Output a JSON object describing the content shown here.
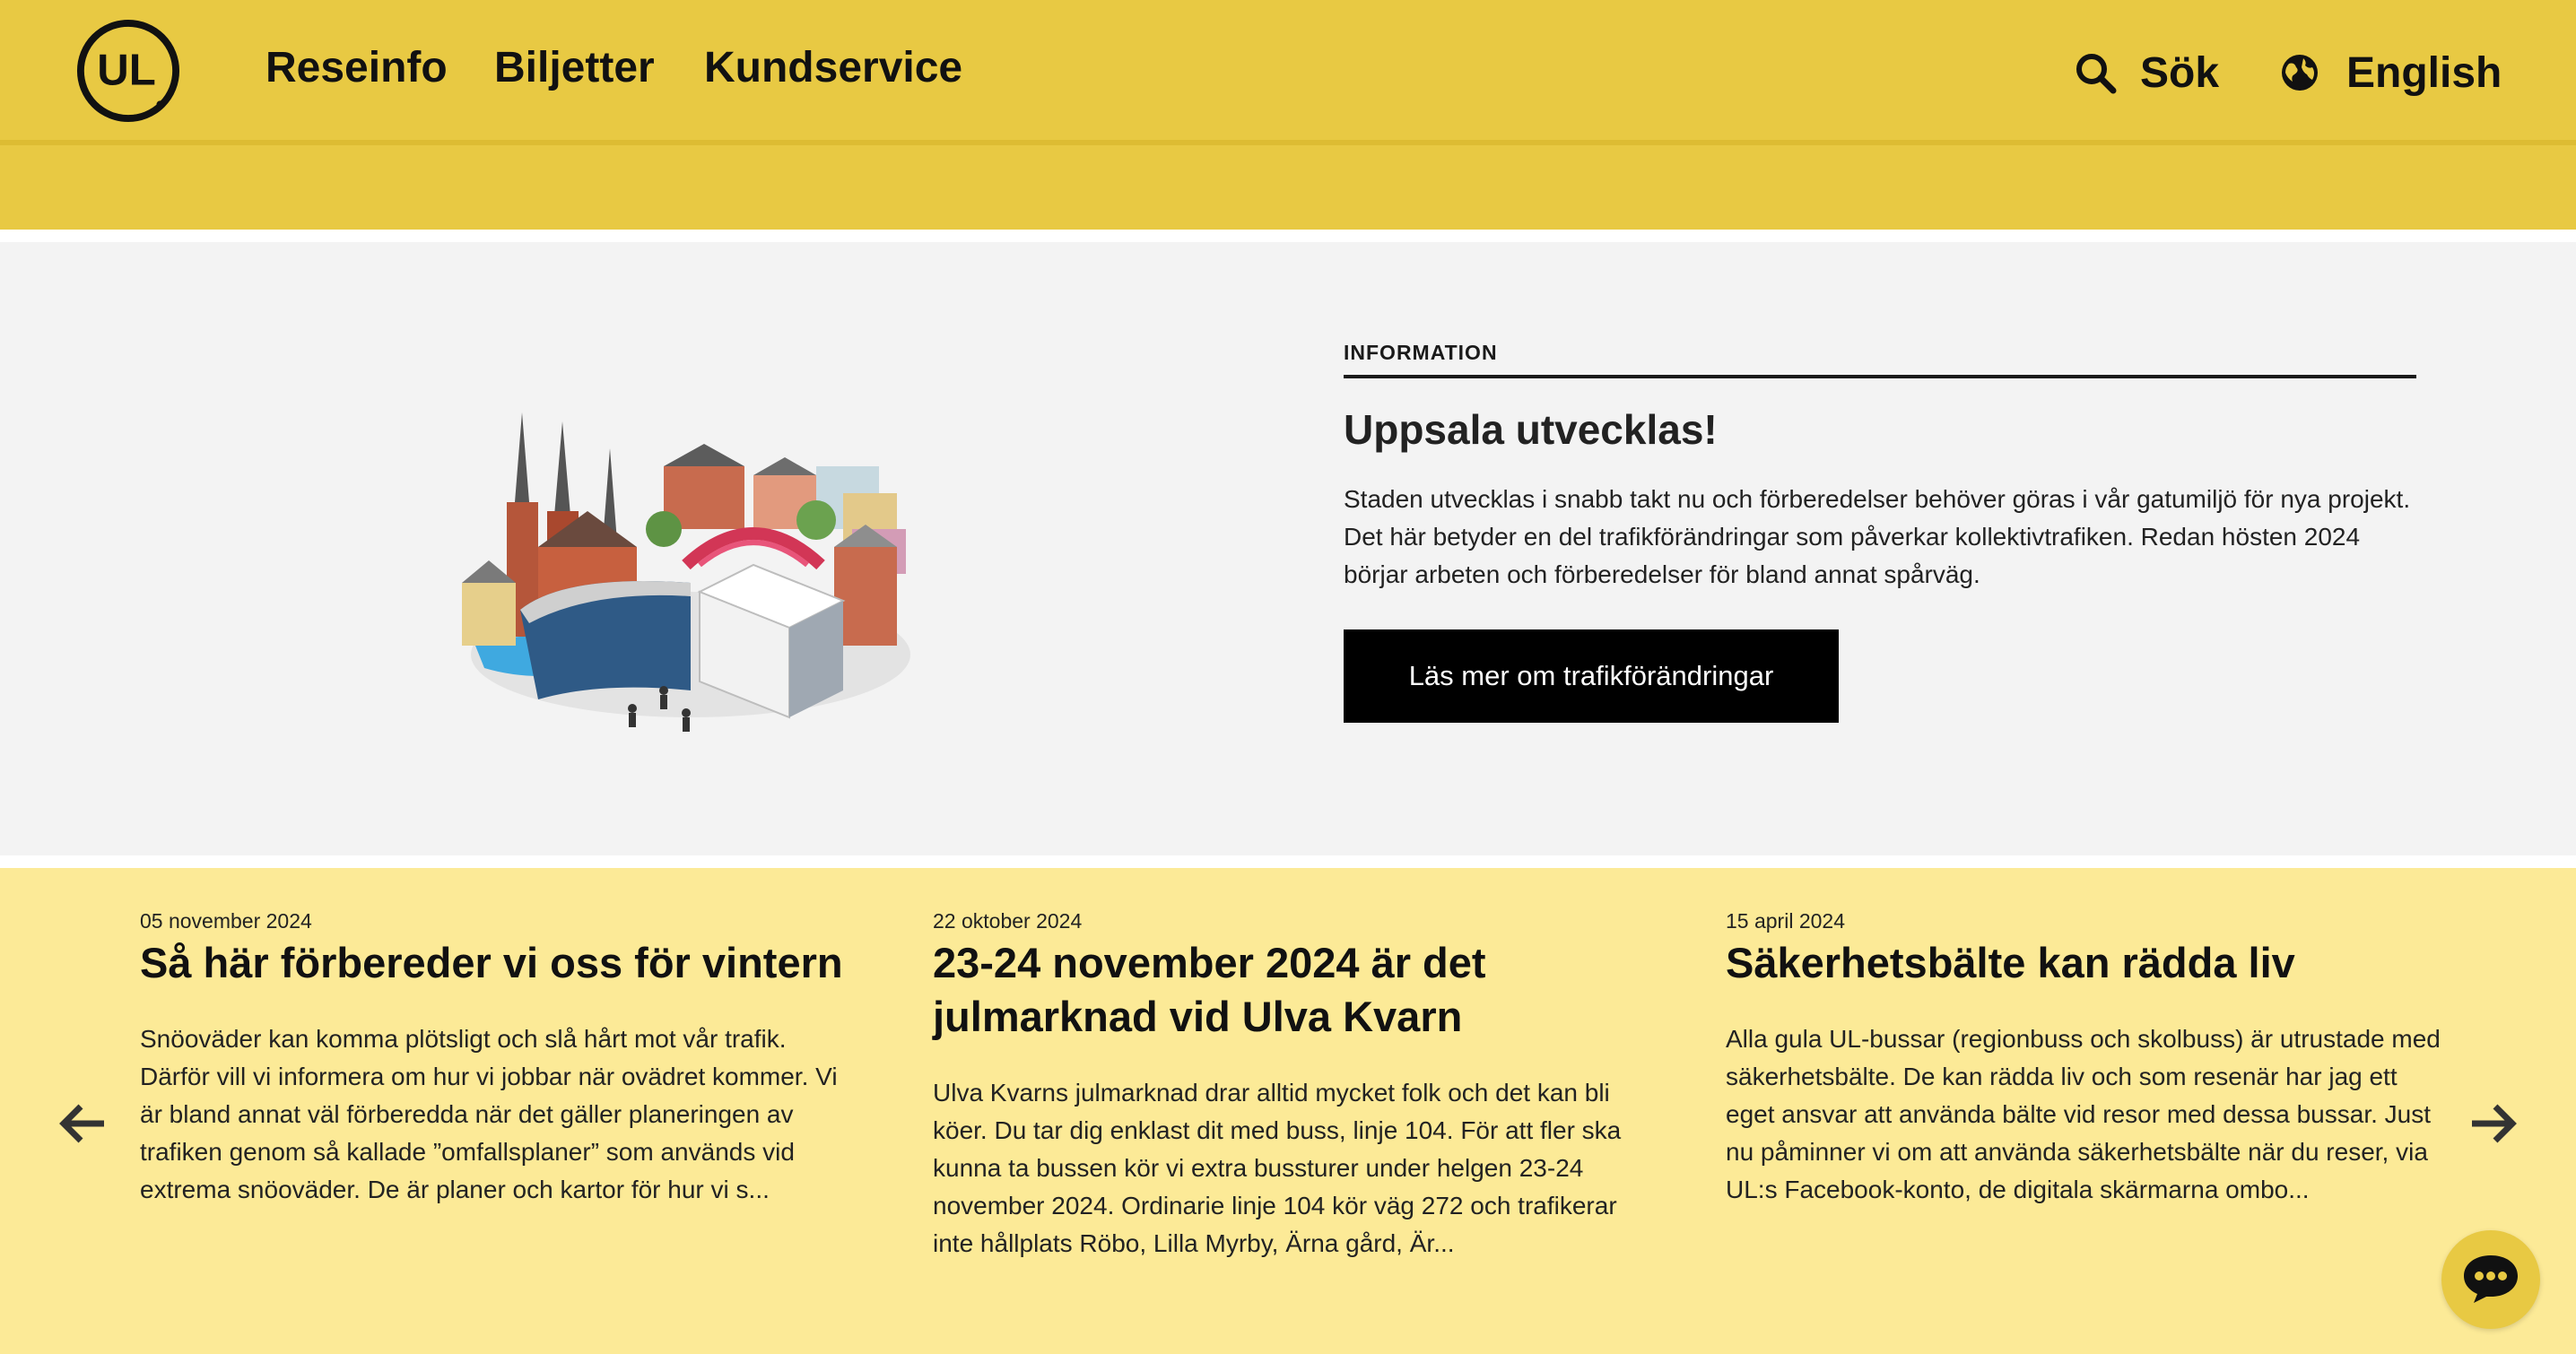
{
  "header": {
    "logo_text": "UL",
    "nav": [
      {
        "label": "Reseinfo"
      },
      {
        "label": "Biljetter"
      },
      {
        "label": "Kundservice"
      }
    ],
    "search_label": "Sök",
    "search_icon": "search-icon",
    "language_label": "English",
    "language_icon": "globe-icon"
  },
  "info": {
    "label": "INFORMATION",
    "title": "Uppsala utvecklas!",
    "text": "Staden utvecklas i snabb takt nu och förberedelser behöver göras i vår gatumiljö för nya projekt. Det här betyder en del trafikförändringar som påverkar kollektivtrafiken. Redan hösten 2024 börjar arbeten och förberedelser för bland annat spårväg.",
    "button_label": "Läs mer om trafikförändringar"
  },
  "news": {
    "items": [
      {
        "date": "05 november 2024",
        "title": "Så här förbereder vi oss för vintern",
        "text": "Snöoväder kan komma plötsligt och slå hårt mot vår trafik. Därför vill vi informera om hur vi jobbar när ovädret kommer. Vi är bland annat väl förberedda när det gäller planeringen av trafiken genom så kallade ”omfallsplaner” som används vid extrema snöoväder. De är planer och kartor för hur vi s..."
      },
      {
        "date": "22 oktober 2024",
        "title": "23-24 november 2024 är det julmarknad vid Ulva Kvarn",
        "text": "Ulva Kvarns julmarknad drar alltid mycket folk och det kan bli köer. Du tar dig enklast dit med buss, linje 104. För att fler ska kunna ta bussen kör vi extra bussturer under helgen 23-24 november 2024. Ordinarie linje 104 kör väg 272 och trafikerar inte hållplats Röbo, Lilla Myrby, Ärna gård, Är..."
      },
      {
        "date": "15 april 2024",
        "title": "Säkerhetsbälte kan rädda liv",
        "text": "Alla gula UL-bussar (regionbuss och skolbuss) är utrustade med säkerhetsbälte. De kan rädda liv och som resenär har jag ett eget ansvar att använda bälte vid resor med dessa bussar. Just nu påminner vi om att använda säkerhetsbälte när du reser, via UL:s Facebook-konto, de digitala skärmarna ombo..."
      }
    ],
    "prev_icon": "arrow-left-icon",
    "next_icon": "arrow-right-icon"
  },
  "chat": {
    "icon": "chat-icon"
  },
  "colors": {
    "brand_yellow": "#E8C943",
    "news_background": "#FCEA97",
    "info_background": "#F3F3F3",
    "button_black": "#000000"
  }
}
